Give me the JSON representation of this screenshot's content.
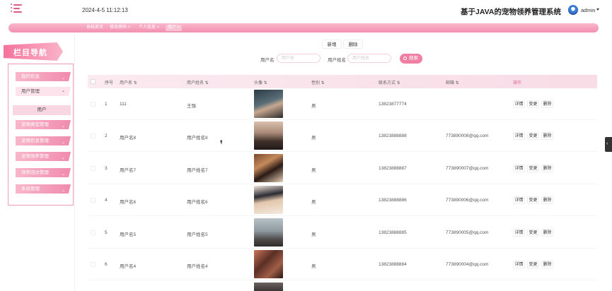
{
  "header": {
    "datetime": "2024-4-5 11:12:13",
    "system_title": "基于JAVA的宠物领养管理系统",
    "user": "admin"
  },
  "tabs": [
    {
      "label": "系统首页"
    },
    {
      "label": "修改密码 ×"
    },
    {
      "label": "个人信息 ×"
    },
    {
      "label": "用户 ×"
    }
  ],
  "sidebar": {
    "banner": "栏目导航",
    "items": [
      {
        "label": "我的信息"
      },
      {
        "label": "用户管理"
      },
      {
        "label": "宠物类型管理"
      },
      {
        "label": "宠物信息管理"
      },
      {
        "label": "宠物领养管理"
      },
      {
        "label": "领养回访管理"
      },
      {
        "label": "系统管理"
      }
    ],
    "sub_item": "用户"
  },
  "toolbar": {
    "add": "新增",
    "delete": "删除"
  },
  "search": {
    "username_label": "用户名",
    "username_placeholder": "用户名",
    "realname_label": "用户姓名",
    "realname_placeholder": "用户姓名",
    "button": "搜索"
  },
  "table": {
    "headers": [
      "序号",
      "用户名",
      "用户姓名",
      "头像",
      "性别",
      "联系方式",
      "邮箱",
      "操作"
    ],
    "actions": [
      "详情",
      "变更",
      "删除"
    ],
    "rows": [
      {
        "no": "1",
        "username": "111",
        "realname": "王强",
        "gender": "男",
        "phone": "13823877774",
        "email": ""
      },
      {
        "no": "2",
        "username": "用户名8",
        "realname": "用户姓名8",
        "gender": "男",
        "phone": "13823888888",
        "email": "773890008@qq.com"
      },
      {
        "no": "3",
        "username": "用户名7",
        "realname": "用户姓名7",
        "gender": "男",
        "phone": "13823888887",
        "email": "773890007@qq.com"
      },
      {
        "no": "4",
        "username": "用户名6",
        "realname": "用户姓名6",
        "gender": "男",
        "phone": "13823888886",
        "email": "773890006@qq.com"
      },
      {
        "no": "5",
        "username": "用户名5",
        "realname": "用户姓名5",
        "gender": "男",
        "phone": "13823888885",
        "email": "773890005@qq.com"
      },
      {
        "no": "6",
        "username": "用户名4",
        "realname": "用户姓名4",
        "gender": "男",
        "phone": "13823888884",
        "email": "773890004@qq.com"
      }
    ]
  },
  "colors": {
    "accent": "#ef7fa3",
    "tabbar": "#f28fb0",
    "nav_banner": "#f4739d"
  }
}
